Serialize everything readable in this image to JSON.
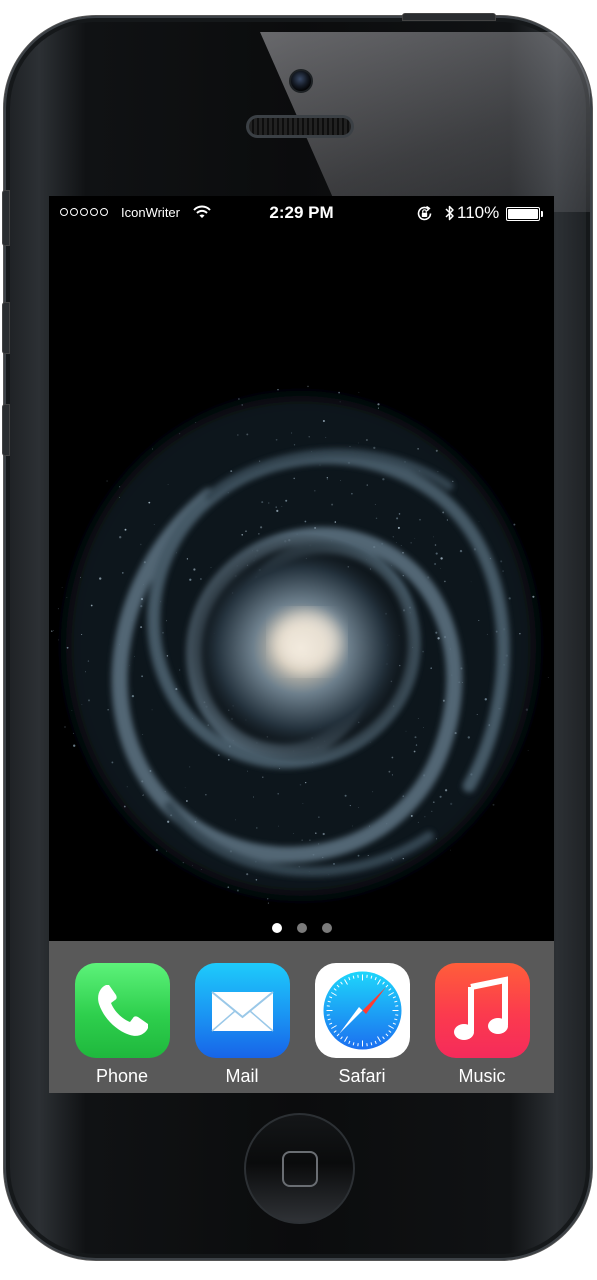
{
  "status_bar": {
    "signal_dots": 5,
    "carrier": "IconWriter",
    "wifi_icon": "wifi-icon",
    "time": "2:29 PM",
    "rotation_lock_icon": "rotation-lock-icon",
    "bluetooth_icon": "bluetooth-icon",
    "battery_percent": "110%",
    "battery_level": 1.0
  },
  "home_screen": {
    "wallpaper": "spiral-galaxy",
    "page_count": 3,
    "current_page": 0
  },
  "dock": {
    "apps": [
      {
        "label": "Phone",
        "icon": "phone-icon",
        "color": "#2fd04e"
      },
      {
        "label": "Mail",
        "icon": "mail-icon",
        "color": "#1f8ff5"
      },
      {
        "label": "Safari",
        "icon": "safari-icon",
        "color": "#1c9af2"
      },
      {
        "label": "Music",
        "icon": "music-icon",
        "color": "#fb3a4e"
      }
    ]
  },
  "colors": {
    "dock_background": "#595959",
    "screen_background": "#000000"
  }
}
